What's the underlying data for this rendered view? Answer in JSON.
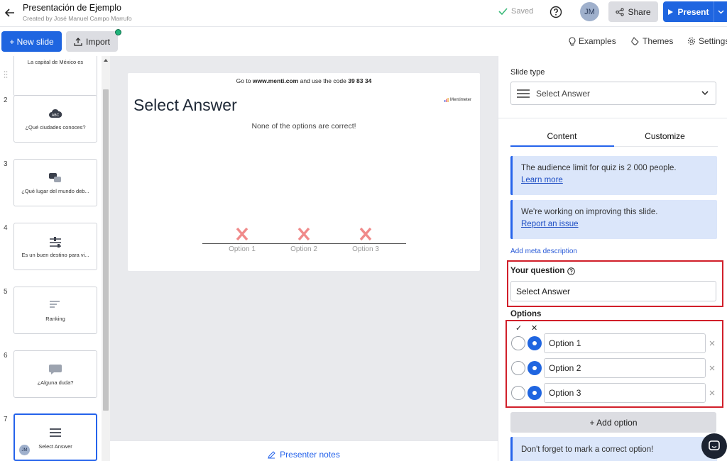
{
  "header": {
    "title": "Presentación de Ejemplo",
    "subtitle": "Created by José Manuel Campo Marrufo",
    "saved_label": "Saved",
    "avatar_initials": "JM",
    "share_label": "Share",
    "present_label": "Present"
  },
  "toolbar": {
    "new_slide_label": "+ New slide",
    "import_label": "Import",
    "examples_label": "Examples",
    "themes_label": "Themes",
    "settings_label": "Settings"
  },
  "slides": [
    {
      "number": "",
      "label": "La capital de México es",
      "icon": "drag-icon"
    },
    {
      "number": "2",
      "label": "¿Qué ciudades conoces?",
      "icon": "word-cloud-icon"
    },
    {
      "number": "3",
      "label": "¿Qué lugar del mundo deb...",
      "icon": "open-ended-icon"
    },
    {
      "number": "4",
      "label": "Es un buen destino para vi...",
      "icon": "scales-icon"
    },
    {
      "number": "5",
      "label": "Ranking",
      "icon": "ranking-icon"
    },
    {
      "number": "6",
      "label": "¿Alguna duda?",
      "icon": "qa-icon"
    },
    {
      "number": "7",
      "label": "Select Answer",
      "icon": "select-answer-icon",
      "avatar": "JM"
    }
  ],
  "slide_preview": {
    "code_prefix": "Go to",
    "code_url": "www.menti.com",
    "code_middle": "and use the code",
    "code_number": "39 83 34",
    "title": "Select Answer",
    "brand": "Mentimeter",
    "subtitle": "None of the options are correct!",
    "options": [
      "Option 1",
      "Option 2",
      "Option 3"
    ]
  },
  "notes_label": "Presenter notes",
  "panel": {
    "slide_type_label": "Slide type",
    "slide_type_value": "Select Answer",
    "tabs": [
      "Content",
      "Customize"
    ],
    "info1_text": "The audience limit for quiz is 2 000 people.",
    "info1_link": "Learn more",
    "info2_text": "We're working on improving this slide.",
    "info2_link": "Report an issue",
    "meta_link": "Add meta description",
    "question_label": "Your question",
    "question_value": "Select Answer",
    "options_label": "Options",
    "check_header": "✓",
    "cross_header": "✕",
    "options": [
      "Option 1",
      "Option 2",
      "Option 3"
    ],
    "add_option_label": "+ Add option",
    "warning_text": "Don't forget to mark a correct option!"
  },
  "colors": {
    "accent": "#1f65e0",
    "highlight": "#d11f2a",
    "wrong_mark": "#f08a8a"
  }
}
